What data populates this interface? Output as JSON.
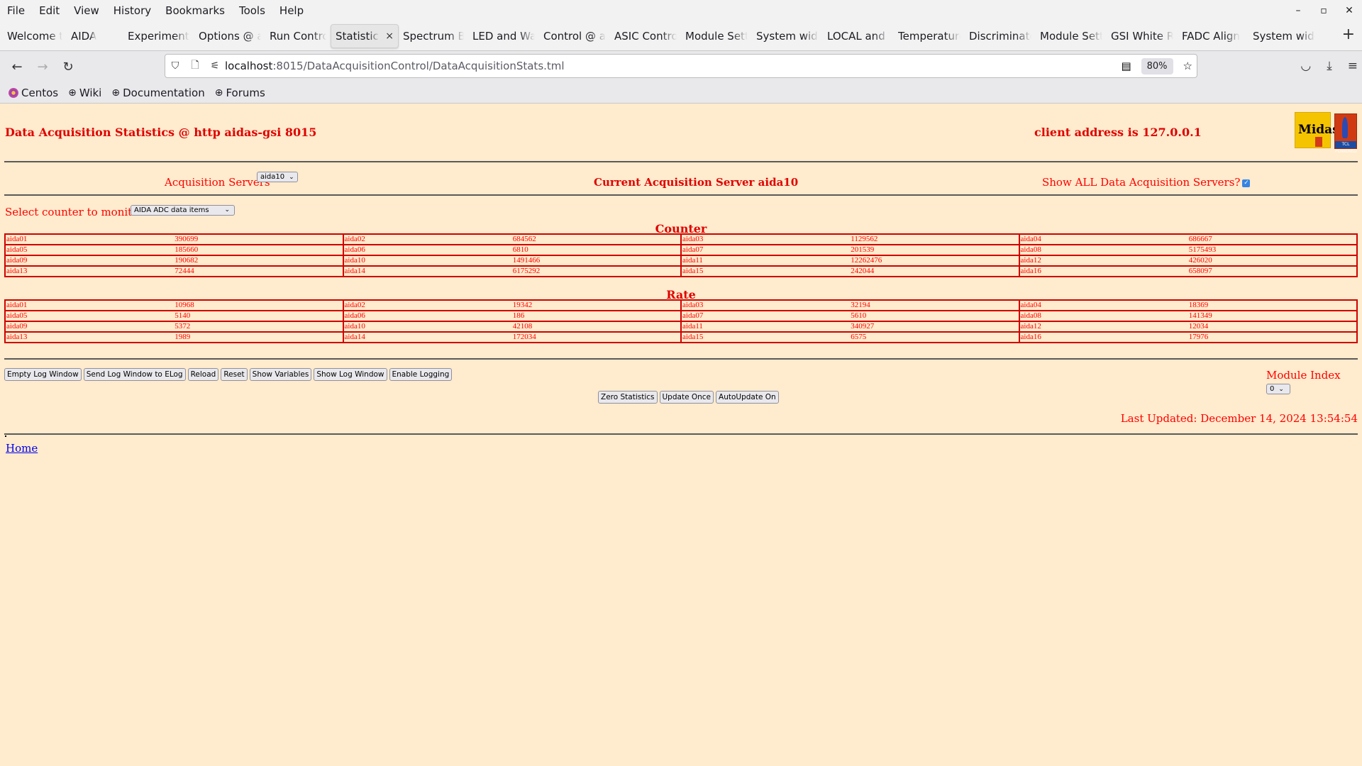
{
  "browser": {
    "menu": [
      "File",
      "Edit",
      "View",
      "History",
      "Bookmarks",
      "Tools",
      "Help"
    ],
    "window_controls": {
      "minimize": "–",
      "maximize": "▫",
      "close": "✕"
    },
    "tabs": [
      {
        "label": "Welcome to",
        "active": false
      },
      {
        "label": "AIDA",
        "active": false
      },
      {
        "label": "Experiment",
        "active": false
      },
      {
        "label": "Options @ a",
        "active": false
      },
      {
        "label": "Run Control",
        "active": false
      },
      {
        "label": "Statistics",
        "active": true
      },
      {
        "label": "Spectrum Br",
        "active": false
      },
      {
        "label": "LED and Wa",
        "active": false
      },
      {
        "label": "Control @ a",
        "active": false
      },
      {
        "label": "ASIC Contro",
        "active": false
      },
      {
        "label": "Module Sett",
        "active": false
      },
      {
        "label": "System wide",
        "active": false
      },
      {
        "label": "LOCAL and V",
        "active": false
      },
      {
        "label": "Temperature",
        "active": false
      },
      {
        "label": "Discriminato",
        "active": false
      },
      {
        "label": "Module Sett",
        "active": false
      },
      {
        "label": "GSI White R",
        "active": false
      },
      {
        "label": "FADC Align",
        "active": false
      },
      {
        "label": "System wide",
        "active": false
      }
    ],
    "new_tab": "+",
    "url": {
      "host": "localhost",
      "path": ":8015/DataAcquisitionControl/DataAcquisitionStats.tml"
    },
    "zoom_level": "80%",
    "bookmarks": [
      {
        "label": "Centos",
        "icon": "centos-icon"
      },
      {
        "label": "Wiki",
        "icon": "globe-icon"
      },
      {
        "label": "Documentation",
        "icon": "globe-icon"
      },
      {
        "label": "Forums",
        "icon": "globe-icon"
      }
    ]
  },
  "page": {
    "title": "Data Acquisition Statistics @ http aidas-gsi 8015",
    "client_address": "client address is 127.0.0.1",
    "logos": {
      "midas": "Midas",
      "tcl": "TCL POWERED"
    },
    "acquisition_servers_label": "Acquisition Servers",
    "acquisition_server_selected": "aida10",
    "current_server": "Current Acquisition Server aida10",
    "show_all_label": "Show ALL Data Acquisition Servers?",
    "show_all_checked": true,
    "counter_select_label": "Select counter to monitor",
    "counter_select_value": "AIDA ADC data items",
    "counter_title": "Counter",
    "counter_rows": [
      [
        [
          "aida01",
          "390699"
        ],
        [
          "aida02",
          "684562"
        ],
        [
          "aida03",
          "1129562"
        ],
        [
          "aida04",
          "686667"
        ]
      ],
      [
        [
          "aida05",
          "185660"
        ],
        [
          "aida06",
          "6810"
        ],
        [
          "aida07",
          "201539"
        ],
        [
          "aida08",
          "5175493"
        ]
      ],
      [
        [
          "aida09",
          "190682"
        ],
        [
          "aida10",
          "1491466"
        ],
        [
          "aida11",
          "12262476"
        ],
        [
          "aida12",
          "426020"
        ]
      ],
      [
        [
          "aida13",
          "72444"
        ],
        [
          "aida14",
          "6175292"
        ],
        [
          "aida15",
          "242044"
        ],
        [
          "aida16",
          "658097"
        ]
      ]
    ],
    "rate_title": "Rate",
    "rate_rows": [
      [
        [
          "aida01",
          "10968"
        ],
        [
          "aida02",
          "19342"
        ],
        [
          "aida03",
          "32194"
        ],
        [
          "aida04",
          "18369"
        ]
      ],
      [
        [
          "aida05",
          "5140"
        ],
        [
          "aida06",
          "186"
        ],
        [
          "aida07",
          "5610"
        ],
        [
          "aida08",
          "141349"
        ]
      ],
      [
        [
          "aida09",
          "5372"
        ],
        [
          "aida10",
          "42108"
        ],
        [
          "aida11",
          "340927"
        ],
        [
          "aida12",
          "12034"
        ]
      ],
      [
        [
          "aida13",
          "1989"
        ],
        [
          "aida14",
          "172034"
        ],
        [
          "aida15",
          "6575"
        ],
        [
          "aida16",
          "17976"
        ]
      ]
    ],
    "buttons_row1": [
      "Empty Log Window",
      "Send Log Window to ELog",
      "Reload",
      "Reset",
      "Show Variables",
      "Show Log Window",
      "Enable Logging"
    ],
    "buttons_row2": [
      "Zero Statistics",
      "Update Once",
      "AutoUpdate On"
    ],
    "module_index_label": "Module Index",
    "module_index_value": "0",
    "last_updated": "Last Updated: December 14, 2024 13:54:54",
    "home_link": "Home"
  }
}
